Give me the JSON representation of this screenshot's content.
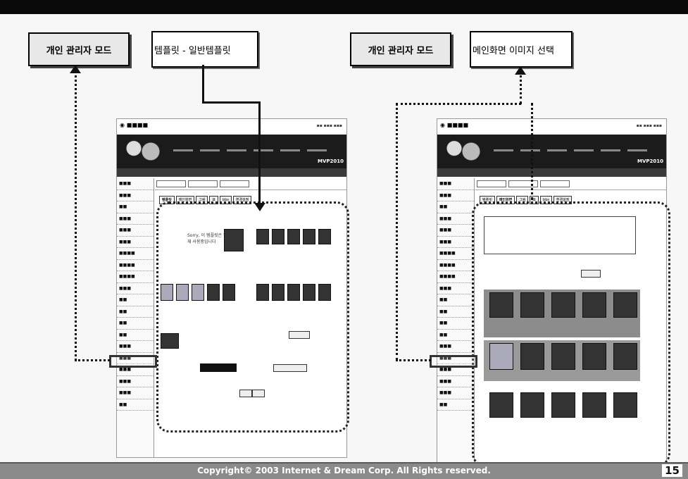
{
  "labels": {
    "left_mode": "개인 관리자 모드",
    "left_desc": "템플릿 - 일반템플릿",
    "right_mode": "개인 관리자 모드",
    "right_desc": "메인화면 이미지 선택"
  },
  "footer": {
    "copyright": "Copyright© 2003 Internet & Dream Corp. All Rights reserved.",
    "page_number": "15"
  },
  "left_screen": {
    "brand": "MVP2010",
    "tabs": [
      "템플릿",
      "메인화면",
      "그림",
      "표",
      "bbs",
      "환경설정"
    ],
    "notice": "Sorry, 이 템플릿은 현재 사용중입니다"
  },
  "right_screen": {
    "brand": "MVP2010",
    "tabs": [
      "템플릿",
      "메인화면",
      "그림",
      "표",
      "bbs",
      "환경설정"
    ]
  },
  "colors": {
    "accent": "#1b1b1b",
    "footer": "#8a8a8a"
  }
}
